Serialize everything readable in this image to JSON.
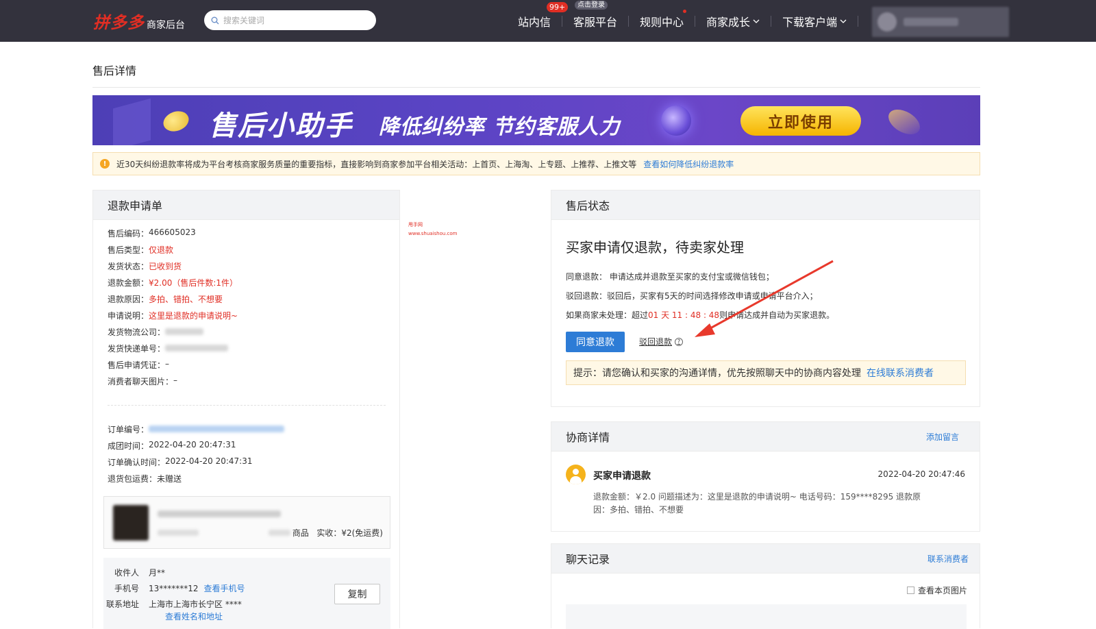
{
  "topbar": {
    "brand": "拼多多",
    "brand_sub": "商家后台",
    "search_placeholder": "搜索关键词",
    "nav": [
      {
        "label": "站内信",
        "badge": "99+"
      },
      {
        "label": "客服平台",
        "bubble": "点击登录"
      },
      {
        "label": "规则中心"
      },
      {
        "label": "商家成长"
      },
      {
        "label": "下载客户端"
      }
    ]
  },
  "page": {
    "title": "售后详情"
  },
  "banner": {
    "title": "售后小助手",
    "subtitle": "降低纠纷率 节约客服人力",
    "cta": "立即使用"
  },
  "notice": {
    "text": "近30天纠纷退款率将成为平台考核商家服务质量的重要指标，直接影响到商家参加平台相关活动：上首页、上海淘、上专题、上推荐、上推文等",
    "link": "查看如何降低纠纷退款率"
  },
  "refund_form": {
    "title": "退款申请单",
    "fields": [
      {
        "label": "售后编码：",
        "value": "466605023"
      },
      {
        "label": "售后类型：",
        "value": "仅退款"
      },
      {
        "label": "发货状态：",
        "value": "已收到货"
      },
      {
        "label": "退款金额：",
        "value": "¥2.00（售后件数:1件）"
      },
      {
        "label": "退款原因：",
        "value": "多拍、错拍、不想要"
      },
      {
        "label": "申请说明：",
        "value": "这里是退款的申请说明~"
      },
      {
        "label": "发货物流公司：",
        "value": ""
      },
      {
        "label": "发货快递单号：",
        "value": ""
      },
      {
        "label": "售后申请凭证：",
        "value": "–"
      },
      {
        "label": "消费者聊天图片：",
        "value": "–"
      }
    ],
    "order_fields": [
      {
        "label": "订单编号：",
        "value": ""
      },
      {
        "label": "成团时间：",
        "value": "2022-04-20 20:47:31"
      },
      {
        "label": "订单确认时间：",
        "value": "2022-04-20 20:47:31"
      },
      {
        "label": "退货包运费：",
        "value": "未赠送"
      }
    ],
    "product": {
      "unit": "商品",
      "paid": "实收：¥2(免运费)"
    },
    "receiver": {
      "name_label": "收件人",
      "name": "月**",
      "phone_label": "手机号",
      "phone": "13*******12",
      "phone_link": "查看手机号",
      "addr_label": "联系地址",
      "addr": "上海市上海市长宁区 ****",
      "addr_link": "查看姓名和地址",
      "copy": "复制"
    }
  },
  "watermark": {
    "line1": "甩手网",
    "line2": "www.shuaishou.com"
  },
  "after_sale_status": {
    "title": "售后状态",
    "headline": "买家申请仅退款，待卖家处理",
    "agree_line": "同意退款：  申请达成并退款至买家的支付宝或微信钱包；",
    "reject_line": "驳回退款：驳回后，买家有5天的时间选择修改申请或申请平台介入；",
    "pending_prefix": "如果商家未处理：超过",
    "countdown": "01 天 11 : 48 : 48",
    "pending_suffix": "则申请达成并自动为买家退款。",
    "agree_button": "同意退款",
    "reject_button": "驳回退款",
    "tip_text": "提示：请您确认和买家的沟通详情，优先按照聊天中的协商内容处理",
    "tip_link": "在线联系消费者"
  },
  "negotiation": {
    "title": "协商详情",
    "add_note": "添加留言",
    "entry": {
      "name": "买家申请退款",
      "time": "2022-04-20 20:47:46",
      "desc": "退款金额：￥2.0 问题描述为：这里是退款的申请说明~ 电话号码：159****8295 退款原因：多拍、错拍、不想要"
    }
  },
  "chat": {
    "title": "聊天记录",
    "contact": "联系消费者",
    "show_images": "查看本页图片"
  },
  "colors": {
    "topbar": "#33323d",
    "brand_red": "#e02e24",
    "link_blue": "#2d7cd6",
    "primary_button": "#2d7cd6",
    "notice_bg": "#fff8e6"
  }
}
